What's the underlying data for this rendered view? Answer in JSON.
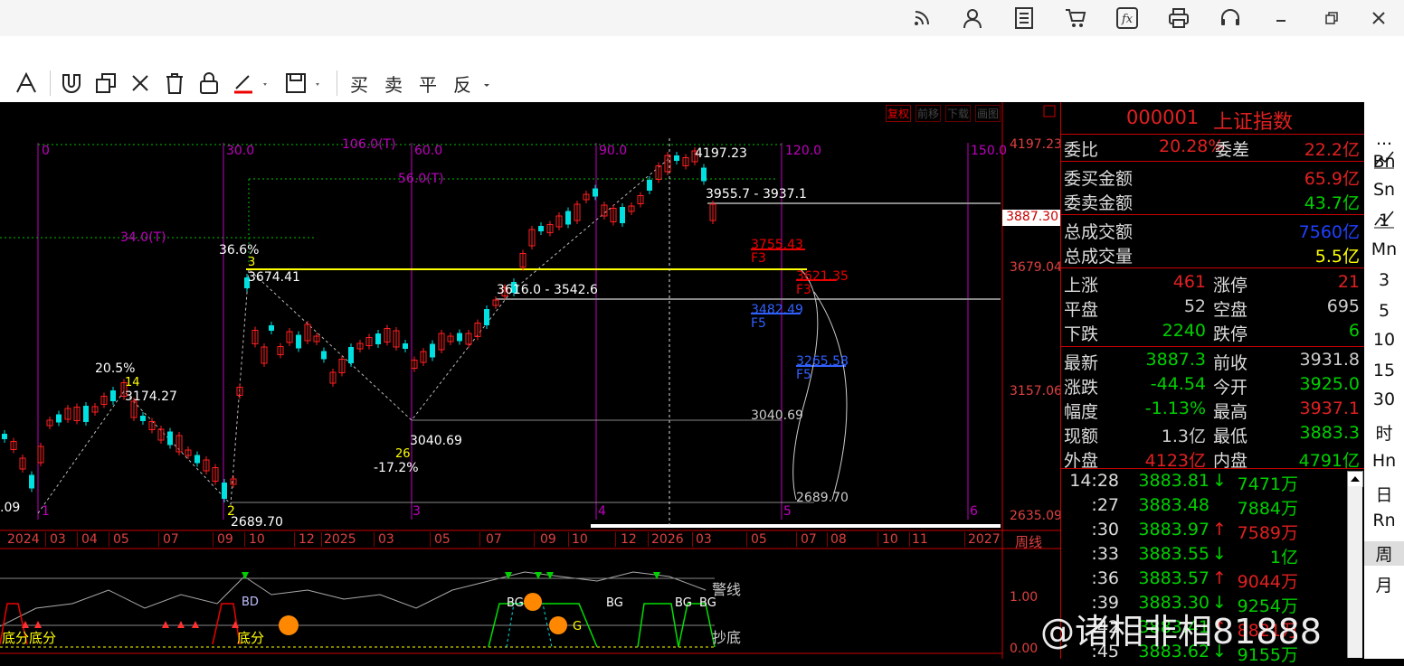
{
  "topbar": {
    "icons": [
      "rss-icon",
      "user-icon",
      "document-icon",
      "cart-icon",
      "formula-icon",
      "printer-icon",
      "headset-icon",
      "minimize-icon",
      "restore-icon",
      "close-icon"
    ]
  },
  "toolbar": {
    "tools": [
      "text-tool-icon",
      "magnet-icon",
      "copy-icon",
      "delete-x-icon",
      "trash-icon",
      "lock-icon",
      "pen-color-icon",
      "save-icon"
    ],
    "trade_buttons": [
      "买",
      "卖",
      "平",
      "反"
    ]
  },
  "chart": {
    "top_buttons": [
      "复权",
      "前移",
      "下载",
      "画图"
    ],
    "price_axis": [
      "4197.23",
      "3887.30",
      "3679.04",
      "3157.06",
      "2635.09"
    ],
    "current_price_tag": "3887.30",
    "time_axis": [
      "2024",
      "03",
      "04",
      "05",
      "07",
      "09",
      "10",
      "12",
      "2025",
      "03",
      "05",
      "07",
      "09",
      "10",
      "12",
      "2026",
      "03",
      "05",
      "07",
      "08",
      "10",
      "11",
      "2027"
    ],
    "period_label": "周线",
    "indicator_labels": [
      "警线",
      "抄底",
      "1.00",
      "0.00"
    ],
    "bottom_text": [
      "底分底分",
      "底分",
      "BD",
      "BG",
      "BG",
      "BG",
      "BG",
      "BG",
      "G"
    ],
    "fib_labels": [
      "0",
      "30.0",
      "106.0(T)",
      "60.0",
      "90.0",
      "120.0",
      "150.0",
      "56.0(T)",
      "34.0(T)"
    ],
    "cycle_numbers": [
      "1",
      "2",
      "3",
      "4",
      "5",
      "6"
    ],
    "annotations": {
      "pct_20_5": "20.5%",
      "pct_36_6": "36.6%",
      "pct_neg17_2": "-17.2%",
      "wave_14": "14",
      "wave_3": "3",
      "wave_26": "26",
      "v3174": "3174.27",
      "v3674": "3674.41",
      "v3040": "3040.69",
      "v2689": "2689.70",
      "v4197": "4197.23",
      "v3955": "3955.7 - 3937.1",
      "v3755": "3755.43",
      "v3621": "3621.35",
      "v3482": "3482.49",
      "v3265": "3265.58",
      "v3040b": "3040.69",
      "v2689b": "2689.70",
      "range3542": "3616.0 - 3542.6",
      "f3a": "F3",
      "f3b": "F3",
      "f5a": "F5",
      "f5b": "F5",
      "v09": ".09"
    }
  },
  "quote": {
    "code": "000001",
    "name": "上证指数",
    "wei_bi_label": "委比",
    "wei_bi": "20.28%",
    "wei_cha_label": "委差",
    "wei_cha": "22.2亿",
    "buy_amt_label": "委买金额",
    "buy_amt": "65.9亿",
    "sell_amt_label": "委卖金额",
    "sell_amt": "43.7亿",
    "total_amt_label": "总成交额",
    "total_amt": "7560亿",
    "total_vol_label": "总成交量",
    "total_vol": "5.5亿",
    "up_label": "上涨",
    "up": "461",
    "limit_up_label": "涨停",
    "limit_up": "21",
    "flat_label": "平盘",
    "flat": "52",
    "suspend_label": "空盘",
    "suspend": "695",
    "down_label": "下跌",
    "down": "2240",
    "limit_down_label": "跌停",
    "limit_down": "6",
    "last_label": "最新",
    "last": "3887.3",
    "prev_label": "前收",
    "prev": "3931.8",
    "chg_label": "涨跌",
    "chg": "-44.54",
    "open_label": "今开",
    "open": "3925.0",
    "pct_label": "幅度",
    "pct": "-1.13%",
    "high_label": "最高",
    "high": "3937.1",
    "cur_amt_label": "现额",
    "cur_amt": "1.3亿",
    "low_label": "最低",
    "low": "3883.3",
    "outer_label": "外盘",
    "outer": "4123亿",
    "inner_label": "内盘",
    "inner": "4791亿"
  },
  "ticks": [
    {
      "time": "14:28",
      "price": "3883.81",
      "dir": "↓",
      "vol": "7471万"
    },
    {
      "time": ":27",
      "price": "3883.48",
      "dir": "",
      "vol": "7884万"
    },
    {
      "time": ":30",
      "price": "3883.97",
      "dir": "↑",
      "vol": "7589万"
    },
    {
      "time": ":33",
      "price": "3883.55",
      "dir": "↓",
      "vol": "1亿"
    },
    {
      "time": ":36",
      "price": "3883.57",
      "dir": "↑",
      "vol": "9044万"
    },
    {
      "time": ":39",
      "price": "3883.30",
      "dir": "↓",
      "vol": "9254万"
    },
    {
      "time": ":42",
      "price": "3883.41",
      "dir": "↑",
      "vol": "8821万"
    },
    {
      "time": ":45",
      "price": "3883.62",
      "dir": "↓",
      "vol": "9155万"
    }
  ],
  "right_periods": [
    "...",
    "Bn",
    "Sn",
    "1",
    "Mn",
    "3",
    "5",
    "10",
    "15",
    "30",
    "时",
    "Hn",
    "日",
    "Rn",
    "周",
    "月"
  ],
  "watermark": "@诸相非相81888",
  "colors": {
    "red": "#ff2020",
    "green": "#00e000",
    "cyan": "#00e0e0",
    "yellow": "#ffff00",
    "magenta": "#ff00ff",
    "blue": "#3060ff"
  }
}
